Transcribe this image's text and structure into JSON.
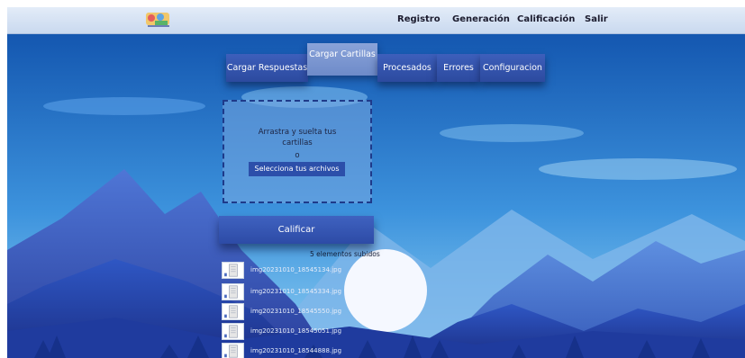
{
  "nav": {
    "items": [
      {
        "label": "Registro"
      },
      {
        "label": "Generación"
      },
      {
        "label": "Calificación"
      },
      {
        "label": "Salir"
      }
    ]
  },
  "tabs": [
    {
      "label": "Cargar Respuestas",
      "active": false
    },
    {
      "label": "Cargar Cartillas",
      "active": true
    },
    {
      "label": "Procesados",
      "active": false
    },
    {
      "label": "Errores",
      "active": false
    },
    {
      "label": "Configuracion",
      "active": false
    }
  ],
  "upload": {
    "line1": "Arrastra y suelta tus",
    "line2": "cartillas",
    "or": "o",
    "select_label": "Selecciona tus archivos"
  },
  "grade_button": "Calificar",
  "count_text": "5 elementos subidos",
  "files": [
    {
      "name": "img20231010_18545134.jpg"
    },
    {
      "name": "img20231010_18545334.jpg"
    },
    {
      "name": "img20231010_18545550.jpg"
    },
    {
      "name": "img20231010_18545051.jpg"
    },
    {
      "name": "img20231010_18544888.jpg"
    }
  ],
  "colors": {
    "sky_top": "#1457b0",
    "sky_bottom": "#7fc6ef",
    "tab": "#3355b0",
    "tab_active": "#7b96d1",
    "button": "#2c4faa"
  },
  "icons": {
    "logo": "app-logo",
    "thumb": "image-thumbnail-icon"
  }
}
